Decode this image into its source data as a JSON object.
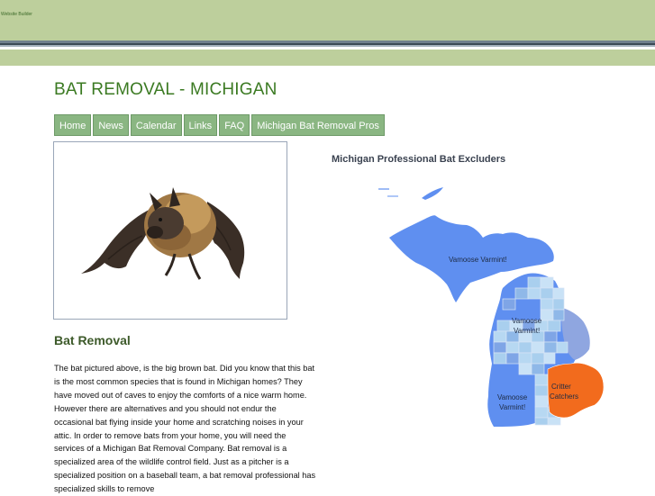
{
  "header": {
    "builder_label": "Website Builder"
  },
  "site": {
    "title": "BAT REMOVAL - MICHIGAN"
  },
  "nav": {
    "items": [
      {
        "label": "Home"
      },
      {
        "label": "News"
      },
      {
        "label": "Calendar"
      },
      {
        "label": "Links"
      },
      {
        "label": "FAQ"
      },
      {
        "label": "Michigan Bat Removal Pros"
      }
    ]
  },
  "article": {
    "heading": "Bat Removal",
    "body": "The bat pictured above, is the big brown bat.  Did you know that this bat is the most common species that is found in Michigan homes?  They have moved out of caves to enjoy the comforts of a nice warm home.  However there are alternatives and you should not endur the occasional bat flying inside your home and scratching noises in your attic.  In order to remove bats from your home, you will need the services of a Michigan Bat Removal Company.  Bat removal is a specialized area of the wildlife control field.  Just as a pitcher is a specialized position on a baseball team, a bat removal professional has specialized skills to remove"
  },
  "map": {
    "heading": "Michigan Professional Bat Excluders",
    "regions": [
      {
        "label": "Vamoose Varmint!",
        "color": "#5f8ff0"
      },
      {
        "label_line1": "Vamoose",
        "label_line2": "Varmint!",
        "color": "#5f8ff0"
      },
      {
        "label_line1": "Vamoose",
        "label_line2": "Varmint!",
        "color": "#5f8ff0"
      },
      {
        "label_line1": "Critter",
        "label_line2": "Catchers",
        "color": "#f26b1d"
      }
    ]
  },
  "colors": {
    "header_green": "#bdcf9c",
    "title_green": "#3b7a22",
    "nav_green": "#8ab682",
    "map_blue": "#5f8ff0",
    "map_orange": "#f26b1d"
  }
}
